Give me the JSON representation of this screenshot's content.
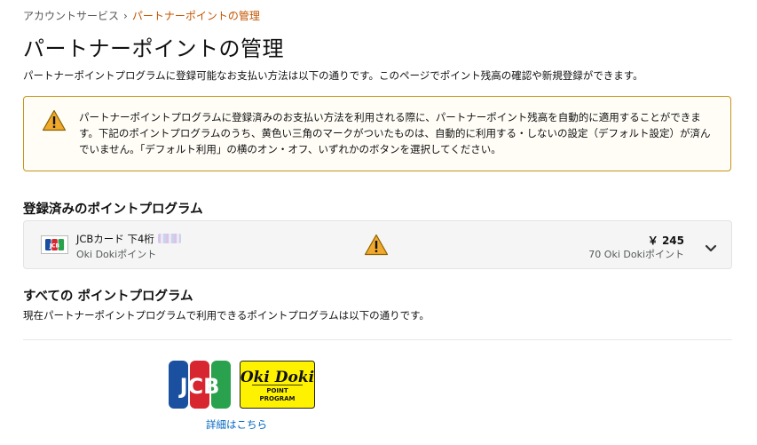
{
  "breadcrumb": {
    "parent": "アカウントサービス",
    "separator": "›",
    "current": "パートナーポイントの管理"
  },
  "page": {
    "title": "パートナーポイントの管理",
    "intro": "パートナーポイントプログラムに登録可能なお支払い方法は以下の通りです。このページでポイント残高の確認や新規登録ができます。"
  },
  "alert": {
    "icon": "warning-icon",
    "text": "パートナーポイントプログラムに登録済みのお支払い方法を利用される際に、パートナーポイント残高を自動的に適用することができます。下記のポイントプログラムのうち、黄色い三角のマークがついたものは、自動的に利用する・しないの設定（デフォルト設定）が済んでいません。「デフォルト利用」の横のオン・オフ、いずれかのボタンを選択してください。"
  },
  "registered": {
    "heading": "登録済みのポイントプログラム",
    "cards": [
      {
        "card_name": "JCBカード 下4桁",
        "program": "Oki Dokiポイント",
        "amount": "￥ 245",
        "points": "70 Oki Dokiポイント",
        "logo": "JCB"
      }
    ]
  },
  "all_programs": {
    "heading": "すべての ポイントプログラム",
    "description": "現在パートナーポイントプログラムで利用できるポイントプログラムは以下の通りです。",
    "program_logos": {
      "jcb": "JCB",
      "okidoki_line1": "Oki Doki",
      "okidoki_line2": "POINT",
      "okidoki_line3": "PROGRAM"
    },
    "detail_link": "詳細はこちら"
  },
  "colors": {
    "accent_orange": "#c45500",
    "warning_border": "#c7941a",
    "warning_fill": "#f0a92c",
    "link": "#0066c0",
    "okidoki_yellow": "#fff200"
  }
}
